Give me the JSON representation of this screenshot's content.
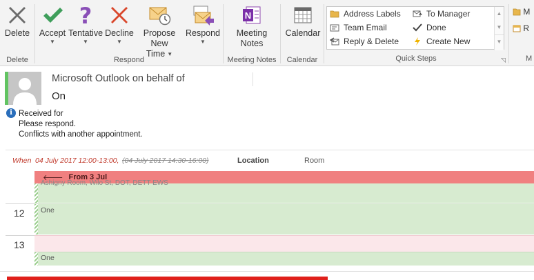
{
  "ribbon": {
    "groups": {
      "delete": "Delete",
      "respond": "Respond",
      "meeting_notes": "Meeting Notes",
      "calendar": "Calendar",
      "quick_steps": "Quick Steps",
      "more": "M"
    },
    "buttons": {
      "delete": "Delete",
      "accept": "Accept",
      "tentative": "Tentative",
      "decline": "Decline",
      "propose_line1": "Propose New",
      "propose_line2": "Time",
      "respond": "Respond",
      "meeting_notes_line1": "Meeting",
      "meeting_notes_line2": "Notes",
      "calendar": "Calendar"
    },
    "quick_steps": [
      "Address Labels",
      "To Manager",
      "Team Email",
      "Done",
      "Reply & Delete",
      "Create New"
    ],
    "right_items": [
      "M",
      "R"
    ]
  },
  "message": {
    "from": "Microsoft Outlook on behalf of",
    "subject": "On",
    "info_lines": [
      "Received for",
      "Please respond.",
      "Conflicts with another appointment."
    ],
    "when_label": "When",
    "when_value": "04 July 2017 12:00-13:00,",
    "when_old": "(04 July 2017 14:30-16:00)",
    "location_label": "Location",
    "location_value": "Room"
  },
  "calendar": {
    "header": "From 3 Jul",
    "clipped_text": "Ashigny Room, Wilo St, DOT, DETT EWS",
    "hours": [
      "12",
      "13"
    ],
    "appointments": [
      "One",
      "One"
    ]
  },
  "colors": {
    "header_bg": "#f08080",
    "appt_bg": "#d7ebd0",
    "when_text": "#c0392b",
    "sender_bar": "#62c462"
  }
}
